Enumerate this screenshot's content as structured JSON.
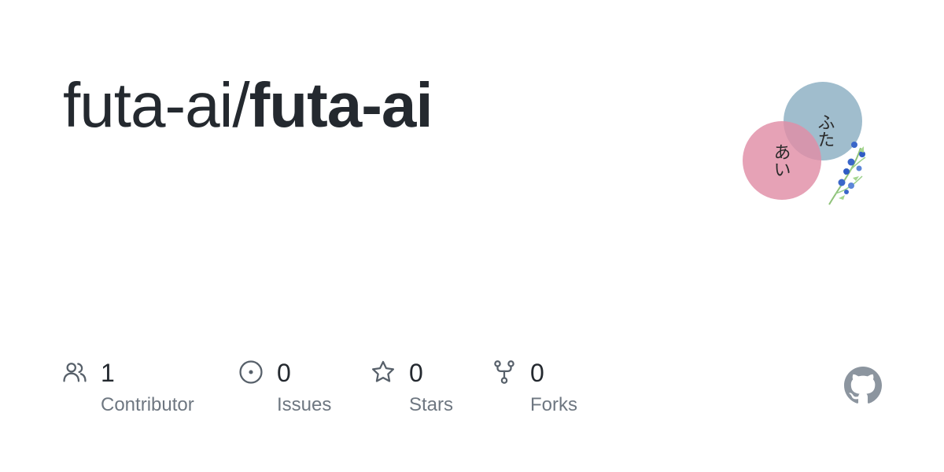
{
  "repo": {
    "owner": "futa-ai",
    "separator": "/",
    "name": "futa-ai"
  },
  "avatar": {
    "top_circle_text": "ふた",
    "bottom_circle_text": "あい",
    "top_circle_color": "#8fb1c4",
    "bottom_circle_color": "#e08ea6"
  },
  "stats": {
    "contributors": {
      "value": "1",
      "label": "Contributor",
      "icon": "people-icon"
    },
    "issues": {
      "value": "0",
      "label": "Issues",
      "icon": "issue-opened-icon"
    },
    "stars": {
      "value": "0",
      "label": "Stars",
      "icon": "star-icon"
    },
    "forks": {
      "value": "0",
      "label": "Forks",
      "icon": "repo-forked-icon"
    }
  },
  "colors": {
    "text_primary": "#24292f",
    "text_muted": "#6e7781",
    "icon": "#57606a",
    "github_mark": "#8c959f"
  }
}
